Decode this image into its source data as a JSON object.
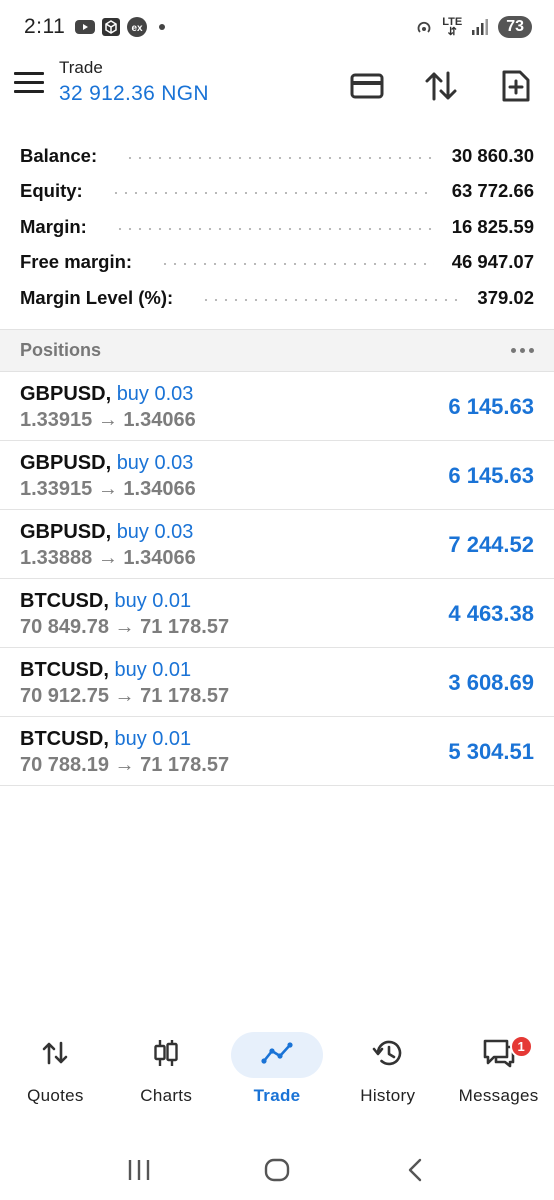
{
  "status_bar": {
    "time": "2:11",
    "network": "LTE",
    "battery": "73",
    "icons": [
      "youtube-icon",
      "app-cube-icon",
      "ex-app-icon",
      "notification-dot-icon",
      "hotspot-icon",
      "lte-icon",
      "signal-icon",
      "battery-icon"
    ],
    "ex_label": "ex"
  },
  "app_bar": {
    "title": "Trade",
    "balance_display": "32 912.36 NGN",
    "actions": [
      "card-icon",
      "sort-arrows-icon",
      "new-order-icon"
    ]
  },
  "summary": {
    "rows": [
      {
        "label": "Balance:",
        "value": "30 860.30"
      },
      {
        "label": "Equity:",
        "value": "63 772.66"
      },
      {
        "label": "Margin:",
        "value": "16 825.59"
      },
      {
        "label": "Free margin:",
        "value": "46 947.07"
      },
      {
        "label": "Margin Level (%):",
        "value": "379.02"
      }
    ]
  },
  "positions": {
    "header": "Positions",
    "arrow": "→",
    "items": [
      {
        "symbol": "GBPUSD,",
        "side": "buy 0.03",
        "open": "1.33915",
        "current": "1.34066",
        "profit": "6 145.63"
      },
      {
        "symbol": "GBPUSD,",
        "side": "buy 0.03",
        "open": "1.33915",
        "current": "1.34066",
        "profit": "6 145.63"
      },
      {
        "symbol": "GBPUSD,",
        "side": "buy 0.03",
        "open": "1.33888",
        "current": "1.34066",
        "profit": "7 244.52"
      },
      {
        "symbol": "BTCUSD,",
        "side": "buy 0.01",
        "open": "70 849.78",
        "current": "71 178.57",
        "profit": "4 463.38"
      },
      {
        "symbol": "BTCUSD,",
        "side": "buy 0.01",
        "open": "70 912.75",
        "current": "71 178.57",
        "profit": "3 608.69"
      },
      {
        "symbol": "BTCUSD,",
        "side": "buy 0.01",
        "open": "70 788.19",
        "current": "71 178.57",
        "profit": "5 304.51"
      }
    ]
  },
  "bottom_nav": {
    "items": [
      {
        "label": "Quotes",
        "icon": "quotes-arrows-icon"
      },
      {
        "label": "Charts",
        "icon": "candlestick-icon"
      },
      {
        "label": "Trade",
        "icon": "trend-line-icon",
        "active": true
      },
      {
        "label": "History",
        "icon": "history-clock-icon"
      },
      {
        "label": "Messages",
        "icon": "chat-bubble-icon",
        "badge": "1"
      }
    ]
  },
  "colors": {
    "accent": "#1a73d6",
    "muted": "#7d7d7d",
    "badge": "#e53935",
    "active_pill": "#e7f0fb"
  }
}
